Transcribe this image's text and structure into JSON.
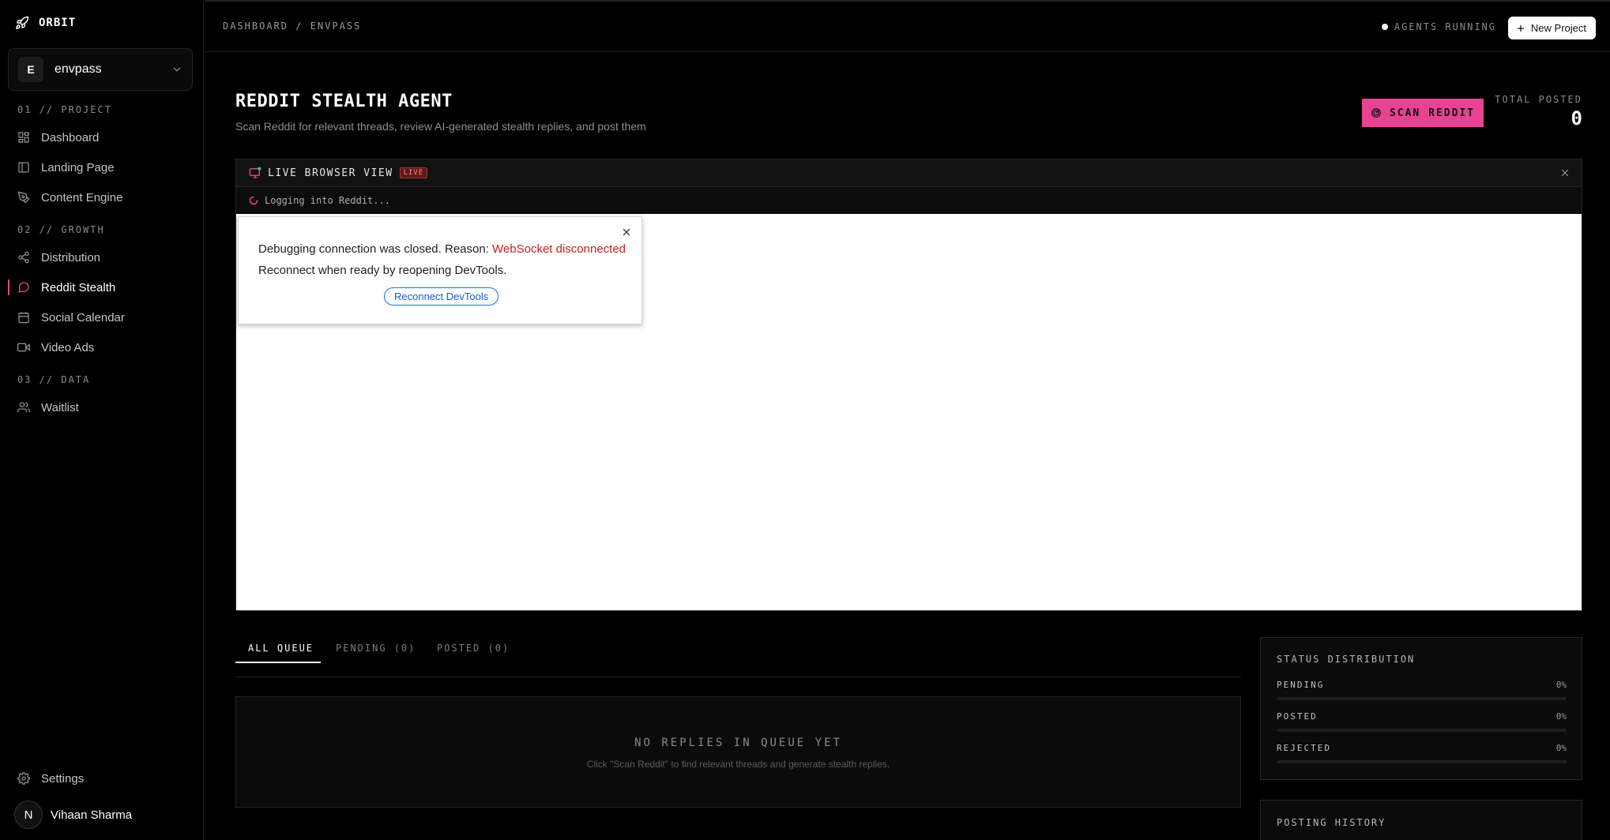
{
  "sidebar": {
    "brand": "ORBIT",
    "project": {
      "initial": "E",
      "name": "envpass"
    },
    "sections": [
      {
        "label": "01 // PROJECT",
        "items": [
          {
            "label": "Dashboard",
            "icon": "grid-icon"
          },
          {
            "label": "Landing Page",
            "icon": "layout-icon"
          },
          {
            "label": "Content Engine",
            "icon": "pen-icon"
          }
        ]
      },
      {
        "label": "02 // GROWTH",
        "items": [
          {
            "label": "Distribution",
            "icon": "share-icon"
          },
          {
            "label": "Reddit Stealth",
            "icon": "chat-icon",
            "active": true
          },
          {
            "label": "Social Calendar",
            "icon": "calendar-icon"
          },
          {
            "label": "Video Ads",
            "icon": "video-icon"
          }
        ]
      },
      {
        "label": "03 // DATA",
        "items": [
          {
            "label": "Waitlist",
            "icon": "users-icon"
          }
        ]
      }
    ],
    "settings_label": "Settings",
    "user": {
      "initial": "N",
      "name": "Vihaan Sharma"
    }
  },
  "topbar": {
    "breadcrumb": "DASHBOARD / ENVPASS",
    "status": "AGENTS RUNNING",
    "new_project": "New Project"
  },
  "header": {
    "title": "REDDIT STEALTH AGENT",
    "subtitle": "Scan Reddit for relevant threads, review AI-generated stealth replies, and post them",
    "scan_button": "SCAN REDDIT",
    "total_label": "TOTAL POSTED",
    "total_value": "0"
  },
  "browser": {
    "title": "LIVE BROWSER VIEW",
    "badge": "LIVE",
    "status": "Logging into Reddit...",
    "dialog": {
      "line1_prefix": "Debugging connection was closed. Reason: ",
      "line1_reason": "WebSocket disconnected",
      "line2": "Reconnect when ready by reopening DevTools.",
      "button": "Reconnect DevTools"
    }
  },
  "tabs": [
    {
      "label": "ALL QUEUE",
      "active": true
    },
    {
      "label": "PENDING (0)"
    },
    {
      "label": "POSTED (0)"
    }
  ],
  "queue": {
    "empty_title": "NO REPLIES IN QUEUE YET",
    "empty_sub": "Click \"Scan Reddit\" to find relevant threads and generate stealth replies."
  },
  "status_distribution": {
    "title": "STATUS DISTRIBUTION",
    "rows": [
      {
        "label": "PENDING",
        "pct": "0%",
        "value": 0
      },
      {
        "label": "POSTED",
        "pct": "0%",
        "value": 0
      },
      {
        "label": "REJECTED",
        "pct": "0%",
        "value": 0
      }
    ]
  },
  "posting_history": {
    "title": "POSTING HISTORY"
  },
  "colors": {
    "accent": "#e84393",
    "background": "#000000",
    "panel": "#0b0b0b",
    "error": "#c5221f",
    "link": "#1a73e8"
  }
}
